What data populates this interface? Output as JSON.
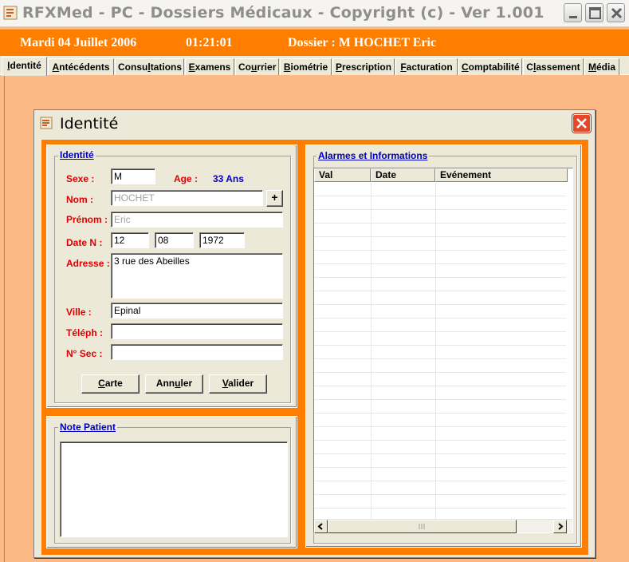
{
  "window": {
    "title": "RFXMed - PC - Dossiers Médicaux - Copyright (c)  - Ver 1.001",
    "icons": [
      "app-icon",
      "minimize-icon",
      "maximize-icon",
      "close-icon"
    ]
  },
  "header": {
    "date": "Mardi 04 Juillet 2006",
    "time": "01:21:01",
    "dossier": "Dossier : M HOCHET Eric",
    "background": "#FF7E00"
  },
  "tabs": [
    {
      "pre": "",
      "u": "I",
      "post": "dentité",
      "active": true
    },
    {
      "pre": "",
      "u": "A",
      "post": "ntécédents"
    },
    {
      "pre": "Consu",
      "u": "l",
      "post": "tations"
    },
    {
      "pre": "",
      "u": "E",
      "post": "xamens"
    },
    {
      "pre": "Co",
      "u": "u",
      "post": "rrier"
    },
    {
      "pre": "",
      "u": "B",
      "post": "iométrie"
    },
    {
      "pre": "",
      "u": "P",
      "post": "rescription"
    },
    {
      "pre": "",
      "u": "F",
      "post": "acturation"
    },
    {
      "pre": "",
      "u": "C",
      "post": "omptabilité"
    },
    {
      "pre": "C",
      "u": "l",
      "post": "assement"
    },
    {
      "pre": "",
      "u": "M",
      "post": "édia"
    }
  ],
  "dialog": {
    "title": "Identité",
    "identite": {
      "group_title": "Identité",
      "sexe_label": "Sexe :",
      "sexe_value": "M",
      "age_label": "Age :",
      "age_value": "33 Ans",
      "nom_label": "Nom :",
      "nom_value": "HOCHET",
      "plus_label": "+",
      "prenom_label": "Prénom :",
      "prenom_value": "Eric",
      "date_label": "Date N :",
      "date_day": "12",
      "date_month": "08",
      "date_year": "1972",
      "adresse_label": "Adresse :",
      "adresse_value": "3 rue des Abeilles",
      "ville_label": "Ville :",
      "ville_value": "Epinal",
      "tel_label": "Téléph :",
      "tel_value": "",
      "nsec_label": "N° Sec :",
      "nsec_value": "",
      "btn_carte": {
        "u": "C",
        "post": "arte"
      },
      "btn_annuler": {
        "pre": "Ann",
        "u": "u",
        "post": "ler"
      },
      "btn_valider": {
        "u": "V",
        "post": "alider"
      }
    },
    "note": {
      "group_title": "Note Patient",
      "value": ""
    },
    "alarmes": {
      "group_title": "Alarmes et Informations",
      "columns": [
        "Val",
        "Date",
        "Evénement"
      ],
      "rows": []
    }
  }
}
